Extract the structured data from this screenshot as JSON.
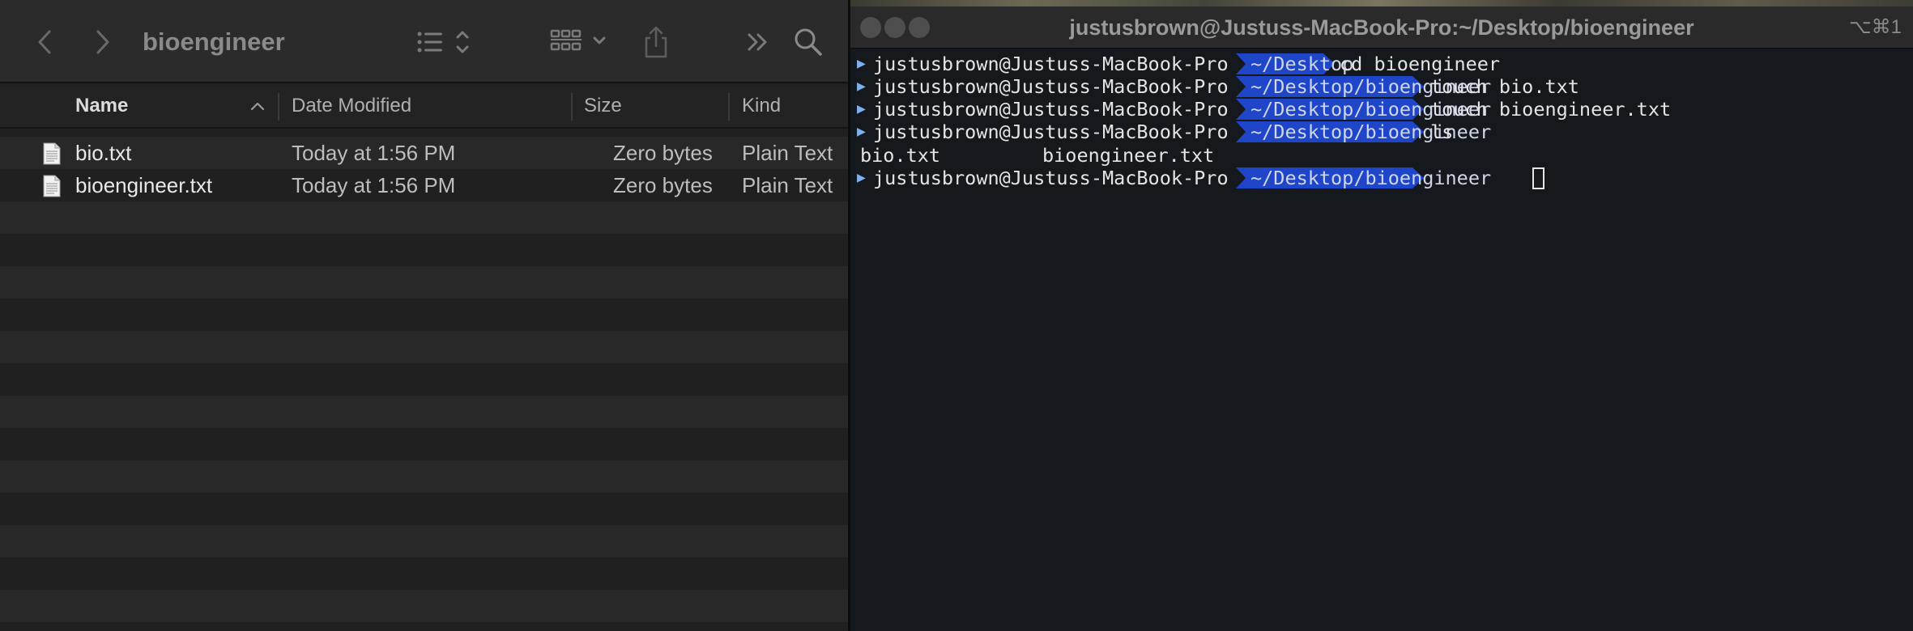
{
  "finder": {
    "title": "bioengineer",
    "columns": {
      "name": "Name",
      "date_modified": "Date Modified",
      "size": "Size",
      "kind": "Kind"
    },
    "files": [
      {
        "name": "bio.txt",
        "date": "Today at 1:56 PM",
        "size": "Zero bytes",
        "kind": "Plain Text"
      },
      {
        "name": "bioengineer.txt",
        "date": "Today at 1:56 PM",
        "size": "Zero bytes",
        "kind": "Plain Text"
      }
    ],
    "icons": {
      "back": "chevron-left-icon",
      "forward": "chevron-right-icon",
      "view": "list-view-icon",
      "group": "grid-group-icon",
      "share": "share-icon",
      "more": "double-chevron-icon",
      "search": "search-icon"
    }
  },
  "terminal": {
    "title": "justusbrown@Justuss-MacBook-Pro:~/Desktop/bioengineer",
    "shortcut": "⌥⌘1",
    "prompt_user": "justusbrown@Justuss-MacBook-Pro",
    "lines": [
      {
        "path": "~/Desktop",
        "command": "cd bioengineer"
      },
      {
        "path": "~/Desktop/bioengineer",
        "command": "touch bio.txt"
      },
      {
        "path": "~/Desktop/bioengineer",
        "command": "touch bioengineer.txt"
      },
      {
        "path": "~/Desktop/bioengineer",
        "command": "ls"
      }
    ],
    "ls_output": [
      "bio.txt",
      "bioengineer.txt"
    ],
    "current_path": "~/Desktop/bioengineer",
    "colors": {
      "prompt_segment": "#1f45c8",
      "background": "#15191d"
    }
  }
}
